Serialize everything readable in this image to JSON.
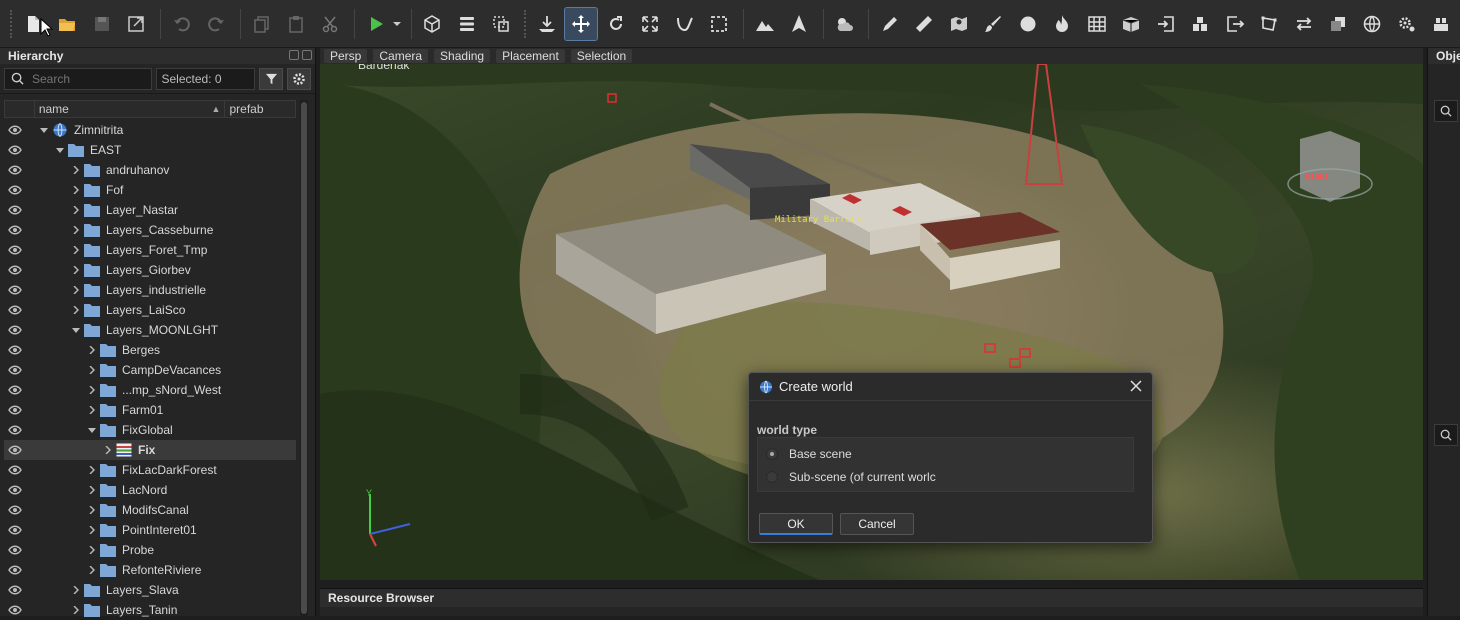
{
  "hierarchy": {
    "title": "Hierarchy",
    "search_placeholder": "Search",
    "selected": "Selected: 0",
    "columns": {
      "name": "name",
      "prefab": "prefab"
    },
    "tree": [
      {
        "label": "Zimnitrita",
        "depth": 0,
        "expanded": true,
        "type": "world"
      },
      {
        "label": "EAST",
        "depth": 1,
        "expanded": true,
        "type": "folder"
      },
      {
        "label": "andruhanov",
        "depth": 2,
        "expanded": false,
        "type": "folder"
      },
      {
        "label": "Fof",
        "depth": 2,
        "expanded": false,
        "type": "folder"
      },
      {
        "label": "Layer_Nastar",
        "depth": 2,
        "expanded": false,
        "type": "folder"
      },
      {
        "label": "Layers_Casseburne",
        "depth": 2,
        "expanded": false,
        "type": "folder"
      },
      {
        "label": "Layers_Foret_Tmp",
        "depth": 2,
        "expanded": false,
        "type": "folder"
      },
      {
        "label": "Layers_Giorbev",
        "depth": 2,
        "expanded": false,
        "type": "folder"
      },
      {
        "label": "Layers_industrielle",
        "depth": 2,
        "expanded": false,
        "type": "folder"
      },
      {
        "label": "Layers_LaiSco",
        "depth": 2,
        "expanded": false,
        "type": "folder"
      },
      {
        "label": "Layers_MOONLGHT",
        "depth": 2,
        "expanded": true,
        "type": "folder"
      },
      {
        "label": "Berges",
        "depth": 3,
        "expanded": false,
        "type": "folder"
      },
      {
        "label": "CampDeVacances",
        "depth": 3,
        "expanded": false,
        "type": "folder"
      },
      {
        "label": "...mp_sNord_West",
        "depth": 3,
        "expanded": false,
        "type": "folder"
      },
      {
        "label": "Farm01",
        "depth": 3,
        "expanded": false,
        "type": "folder"
      },
      {
        "label": "FixGlobal",
        "depth": 3,
        "expanded": true,
        "type": "folder"
      },
      {
        "label": "Fix",
        "depth": 4,
        "expanded": false,
        "type": "layer",
        "selected": true
      },
      {
        "label": "FixLacDarkForest",
        "depth": 3,
        "expanded": false,
        "type": "folder"
      },
      {
        "label": "LacNord",
        "depth": 3,
        "expanded": false,
        "type": "folder"
      },
      {
        "label": "ModifsCanal",
        "depth": 3,
        "expanded": false,
        "type": "folder"
      },
      {
        "label": "PointInteret01",
        "depth": 3,
        "expanded": false,
        "type": "folder"
      },
      {
        "label": "Probe",
        "depth": 3,
        "expanded": false,
        "type": "folder"
      },
      {
        "label": "RefonteRiviere",
        "depth": 3,
        "expanded": false,
        "type": "folder"
      },
      {
        "label": "Layers_Slava",
        "depth": 2,
        "expanded": false,
        "type": "folder"
      },
      {
        "label": "Layers_Tanin",
        "depth": 2,
        "expanded": false,
        "type": "folder"
      }
    ]
  },
  "viewport": {
    "tabs": [
      "Persp",
      "Camera",
      "Shading",
      "Placement",
      "Selection"
    ],
    "scene_label": "Military Barracks",
    "gizmo_label": "RIGHT",
    "top_text": "Bardenak"
  },
  "right_panel": {
    "title": "Obje"
  },
  "bottom_panel": {
    "title": "Resource Browser"
  },
  "dialog": {
    "title": "Create world",
    "section_label": "world type",
    "options": [
      {
        "label": "Base scene",
        "selected": true
      },
      {
        "label": "Sub-scene (of current worlc",
        "selected": false
      }
    ],
    "ok_label": "OK",
    "cancel_label": "Cancel"
  },
  "colors": {
    "accent": "#3d7bd9",
    "folder": "#7fa7d6",
    "play": "#4cc24c"
  }
}
